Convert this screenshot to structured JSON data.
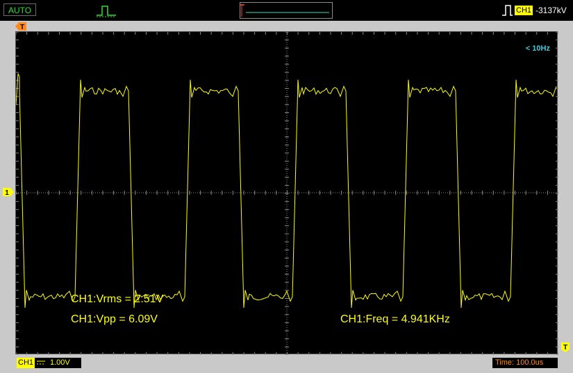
{
  "topbar": {
    "mode": "AUTO",
    "trigger_type_icon": "pulse-trigger-icon",
    "overview_icon": "waveform-overview-icon",
    "trigger_edge_icon": "rising-edge-icon",
    "trigger_channel": "CH1",
    "trigger_level": "-3137kV"
  },
  "screen": {
    "freq_range": "< 10Hz",
    "trigger_pos_marker": "T",
    "channel_marker": "1",
    "trigger_level_marker": "T"
  },
  "measurements": {
    "vrms": "CH1:Vrms = 2.51V",
    "vpp": "CH1:Vpp = 6.09V",
    "freq": "CH1:Freq = 4.941KHz"
  },
  "bottombar": {
    "channel": "CH1",
    "coupling_icon": "dc-coupling-icon",
    "volts_per_div": "1.00V",
    "time_per_div": "Time: 100.0us"
  },
  "colors": {
    "trace": "#ffff00",
    "mode_text": "#2fe02f",
    "freq_range_text": "#2fd0e0",
    "time_text": "#ff8a1a",
    "trigger_marker": "#ff8a1a",
    "grid": "#8a8a8a"
  }
}
